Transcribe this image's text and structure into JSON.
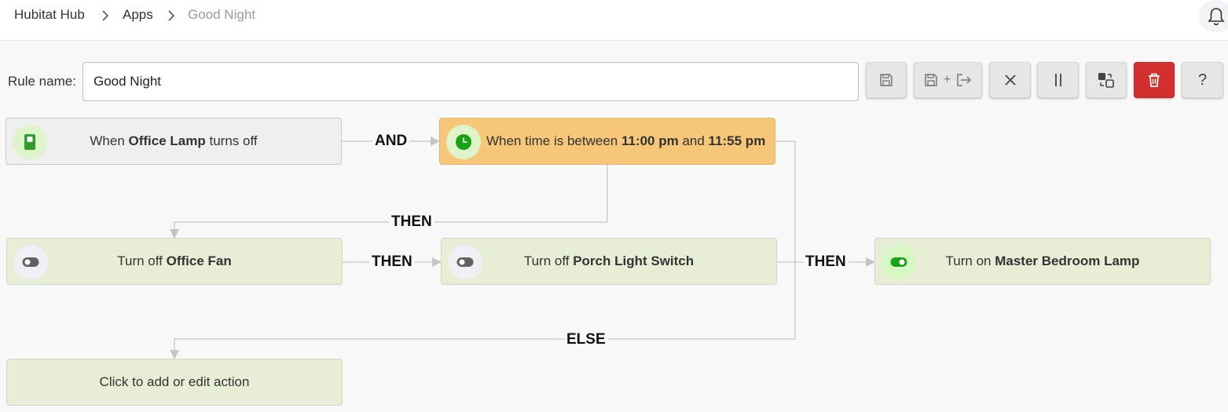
{
  "breadcrumb": {
    "hub": "Hubitat Hub",
    "sep1": ">",
    "apps": "Apps",
    "sep2": ">",
    "current": "Good Night"
  },
  "rule": {
    "label": "Rule name:",
    "value": "Good Night"
  },
  "toolbar": {
    "save_icon": "save-icon",
    "save_exit_plus": "+",
    "cancel_icon": "close-icon",
    "pause_icon": "pause-icon",
    "swap_icon": "swap-icon",
    "delete_icon": "trash-icon",
    "help_label": "?",
    "delete_color": "#d32f2f"
  },
  "nodes": {
    "trigger1": {
      "pre": "When ",
      "bold": "Office Lamp",
      "post": " turns off",
      "icon": "switch-icon"
    },
    "trigger2": {
      "pre": "When time is between ",
      "bold1": "11:00 pm",
      "mid": " and ",
      "bold2": "11:55 pm",
      "icon": "clock-icon"
    },
    "action1": {
      "pre": "Turn off ",
      "bold": "Office Fan",
      "icon": "toggle-off-icon"
    },
    "action2": {
      "pre": "Turn off ",
      "bold": "Porch Light Switch",
      "icon": "toggle-off-icon"
    },
    "action3": {
      "pre": "Turn on ",
      "bold": "Master Bedroom Lamp",
      "icon": "toggle-on-icon"
    },
    "else_action": {
      "text": "Click to add or edit action"
    }
  },
  "connectors": {
    "and": "AND",
    "then_down": "THEN",
    "then_mid": "THEN",
    "then_right": "THEN",
    "else": "ELSE"
  },
  "colors": {
    "condition_fill": "#f6c679",
    "action_fill": "#e6efd6",
    "icon_green": "#1aa317",
    "icon_toggle_off": "#616161"
  }
}
